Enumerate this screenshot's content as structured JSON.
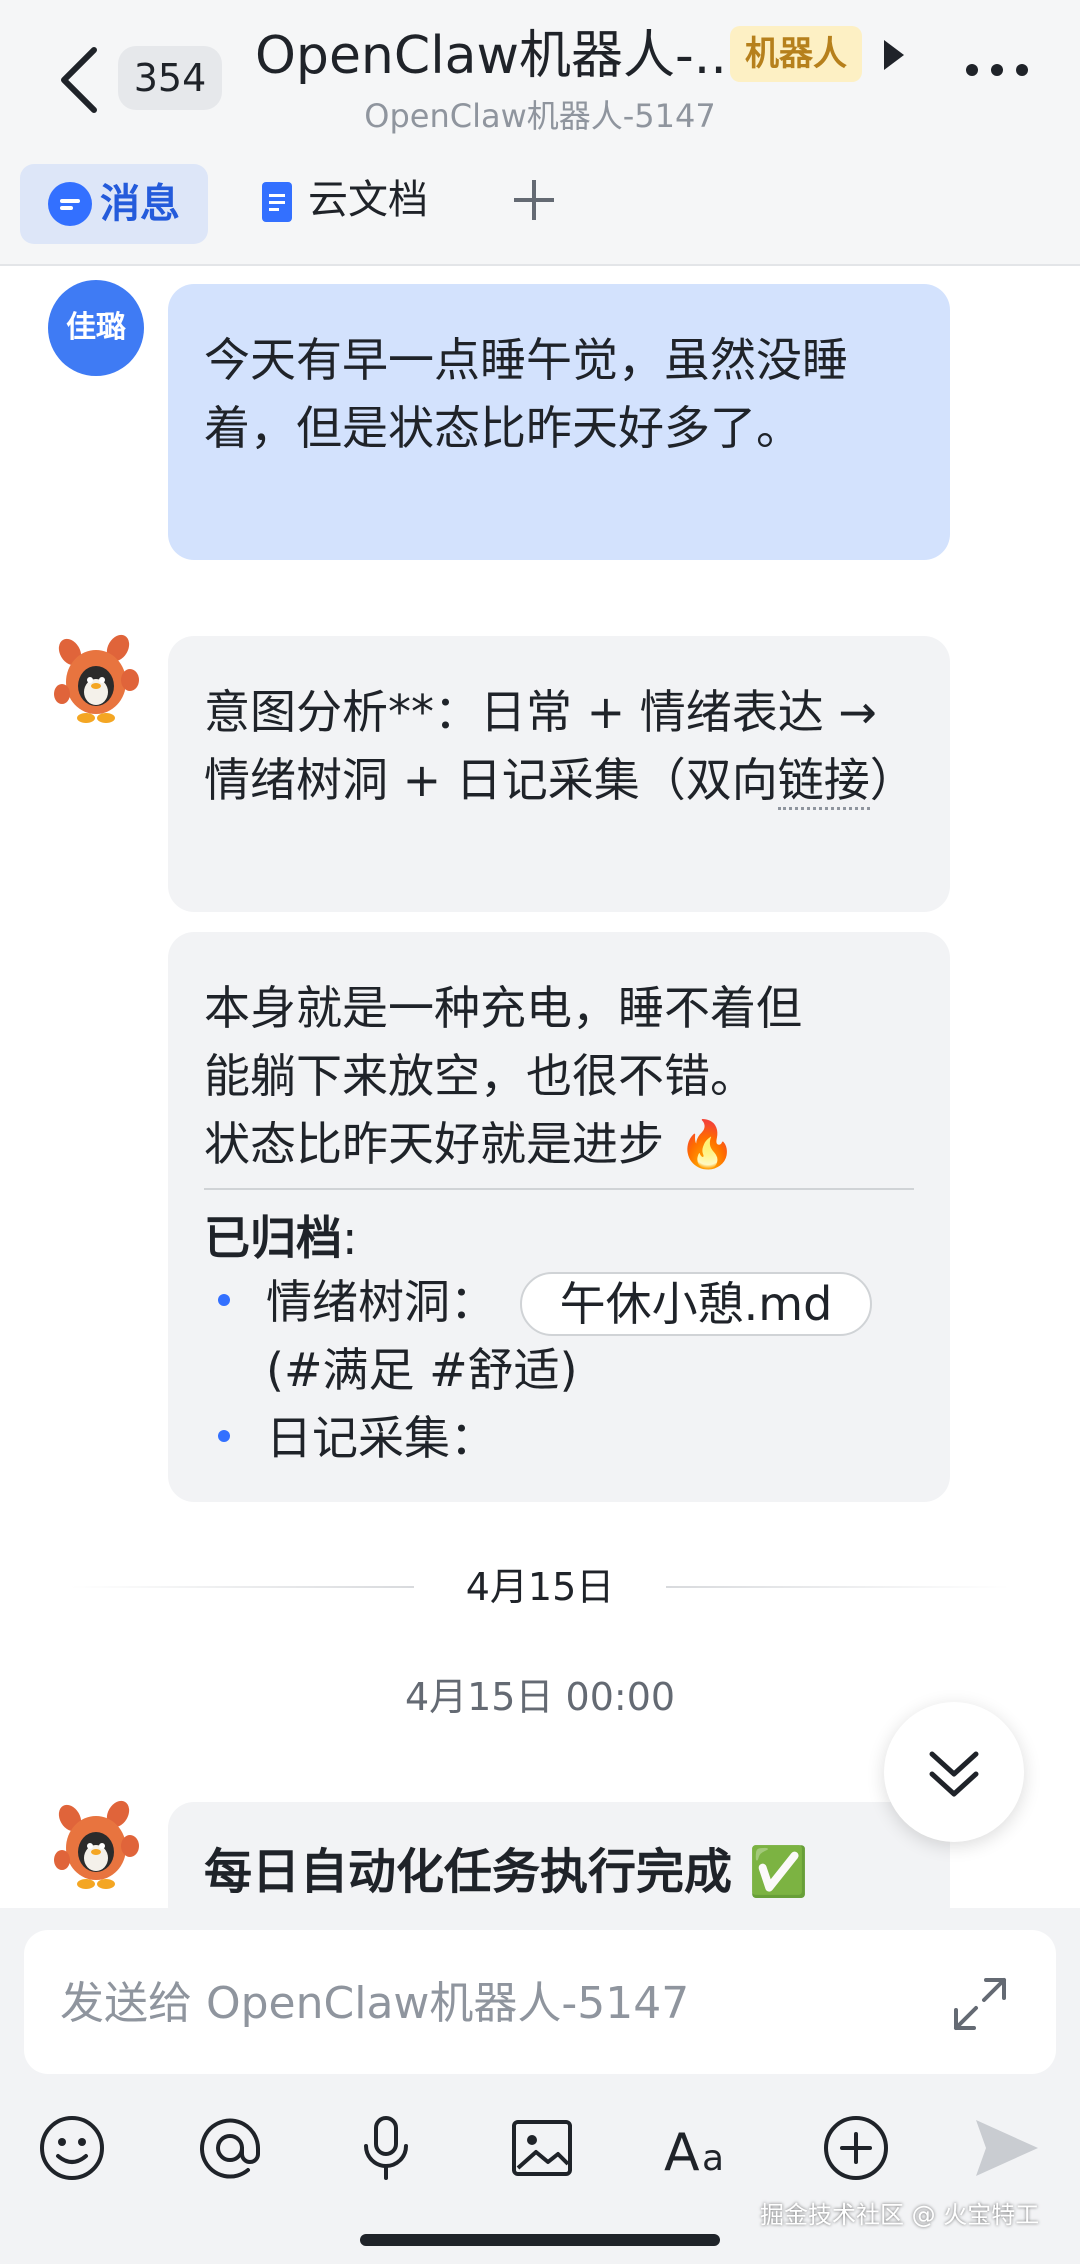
{
  "header": {
    "unread_count": "354",
    "title": "OpenClaw机器人-...",
    "bot_badge": "机器人",
    "subtitle": "OpenClaw机器人-5147"
  },
  "tabs": [
    {
      "label": "消息",
      "icon": "message-icon",
      "active": true
    },
    {
      "label": "云文档",
      "icon": "document-icon",
      "active": false
    }
  ],
  "messages": {
    "user_avatar_text": "佳璐",
    "user_message": "今天有早一点睡午觉，虽然没睡着，但是状态比昨天好多了。",
    "bot_intent_prefix": "意图分析**：日常 + 情绪表达 → 情绪树洞 + 日记采集（双向",
    "bot_intent_link": "链接",
    "bot_intent_suffix": "）",
    "bot_reply_line1": "本身就是一种充电，睡不着但",
    "bot_reply_line2": "能躺下来放空，也很不错。",
    "bot_reply_line3": "状态比昨天好就是进步 🔥",
    "archived_label": "已归档",
    "archived_colon": ":",
    "archive_item1_label": "情绪树洞：",
    "archive_item1_file": "午休小憩.md",
    "archive_item1_tags": "(#满足 #舒适)",
    "archive_item2_label": "日记采集："
  },
  "date_divider": "4月15日",
  "timestamp": "4月15日 00:00",
  "task_message": "每日自动化任务执行完成 ✅",
  "input": {
    "placeholder": "发送给 OpenClaw机器人-5147"
  },
  "toolbar_icons": [
    "emoji-icon",
    "at-icon",
    "microphone-icon",
    "image-icon",
    "font-icon",
    "plus-circle-icon",
    "send-icon"
  ],
  "watermark": "掘金技术社区 @ 火宝特工",
  "colors": {
    "accent": "#3370ff",
    "user_bubble": "#d3e2fd",
    "bot_bubble": "#f2f3f5",
    "badge_bg": "#fdf0c4",
    "badge_text": "#b6801c"
  }
}
